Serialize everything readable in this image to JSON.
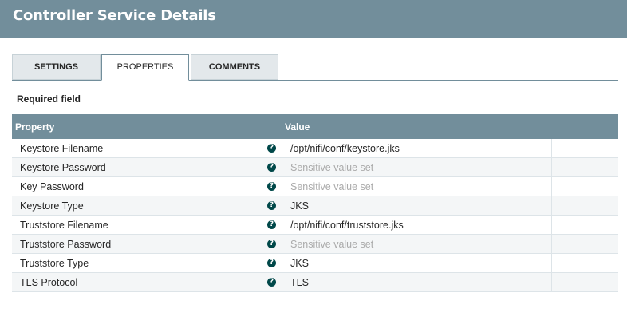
{
  "header": {
    "title": "Controller Service Details"
  },
  "tabs": [
    {
      "label": "SETTINGS"
    },
    {
      "label": "PROPERTIES"
    },
    {
      "label": "COMMENTS"
    }
  ],
  "required_label": "Required field",
  "table": {
    "columns": [
      "Property",
      "Value"
    ],
    "rows": [
      {
        "property": "Keystore Filename",
        "value": "/opt/nifi/conf/keystore.jks",
        "sensitive": false
      },
      {
        "property": "Keystore Password",
        "value": "Sensitive value set",
        "sensitive": true
      },
      {
        "property": "Key Password",
        "value": "Sensitive value set",
        "sensitive": true
      },
      {
        "property": "Keystore Type",
        "value": "JKS",
        "sensitive": false
      },
      {
        "property": "Truststore Filename",
        "value": "/opt/nifi/conf/truststore.jks",
        "sensitive": false
      },
      {
        "property": "Truststore Password",
        "value": "Sensitive value set",
        "sensitive": true
      },
      {
        "property": "Truststore Type",
        "value": "JKS",
        "sensitive": false
      },
      {
        "property": "TLS Protocol",
        "value": "TLS",
        "sensitive": false
      }
    ]
  },
  "icons": {
    "help": "question-circle-icon"
  },
  "colors": {
    "header": "#728e9b",
    "help_icon": "#004849",
    "sensitive_text": "#aaaaaa"
  }
}
